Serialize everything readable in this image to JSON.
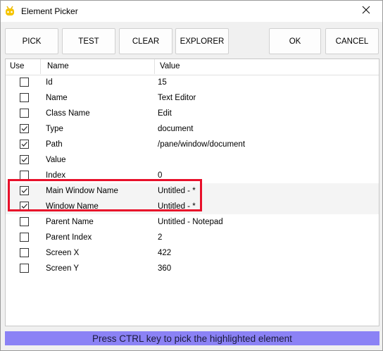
{
  "window": {
    "title": "Element Picker",
    "icon": "robot-icon",
    "close_icon": "close-icon"
  },
  "toolbar": {
    "pick_label": "PICK",
    "test_label": "TEST",
    "clear_label": "CLEAR",
    "explorer_label": "EXPLORER",
    "ok_label": "OK",
    "cancel_label": "CANCEL"
  },
  "grid": {
    "headers": {
      "use": "Use",
      "name": "Name",
      "value": "Value"
    },
    "rows": [
      {
        "checked": false,
        "name": "Id",
        "value": "15"
      },
      {
        "checked": false,
        "name": "Name",
        "value": "Text Editor"
      },
      {
        "checked": false,
        "name": "Class Name",
        "value": "Edit"
      },
      {
        "checked": true,
        "name": "Type",
        "value": "document"
      },
      {
        "checked": true,
        "name": "Path",
        "value": "/pane/window/document"
      },
      {
        "checked": true,
        "name": "Value",
        "value": ""
      },
      {
        "checked": false,
        "name": "Index",
        "value": "0"
      },
      {
        "checked": true,
        "name": "Main Window Name",
        "value": "Untitled - *"
      },
      {
        "checked": true,
        "name": "Window Name",
        "value": "Untitled - *"
      },
      {
        "checked": false,
        "name": "Parent Name",
        "value": "Untitled - Notepad"
      },
      {
        "checked": false,
        "name": "Parent Index",
        "value": "2"
      },
      {
        "checked": false,
        "name": "Screen X",
        "value": "422"
      },
      {
        "checked": false,
        "name": "Screen Y",
        "value": "360"
      }
    ]
  },
  "status": {
    "text": "Press CTRL key to pick the highlighted element"
  },
  "colors": {
    "highlight_box": "#e8102a",
    "status_bar": "#8b82f5"
  }
}
